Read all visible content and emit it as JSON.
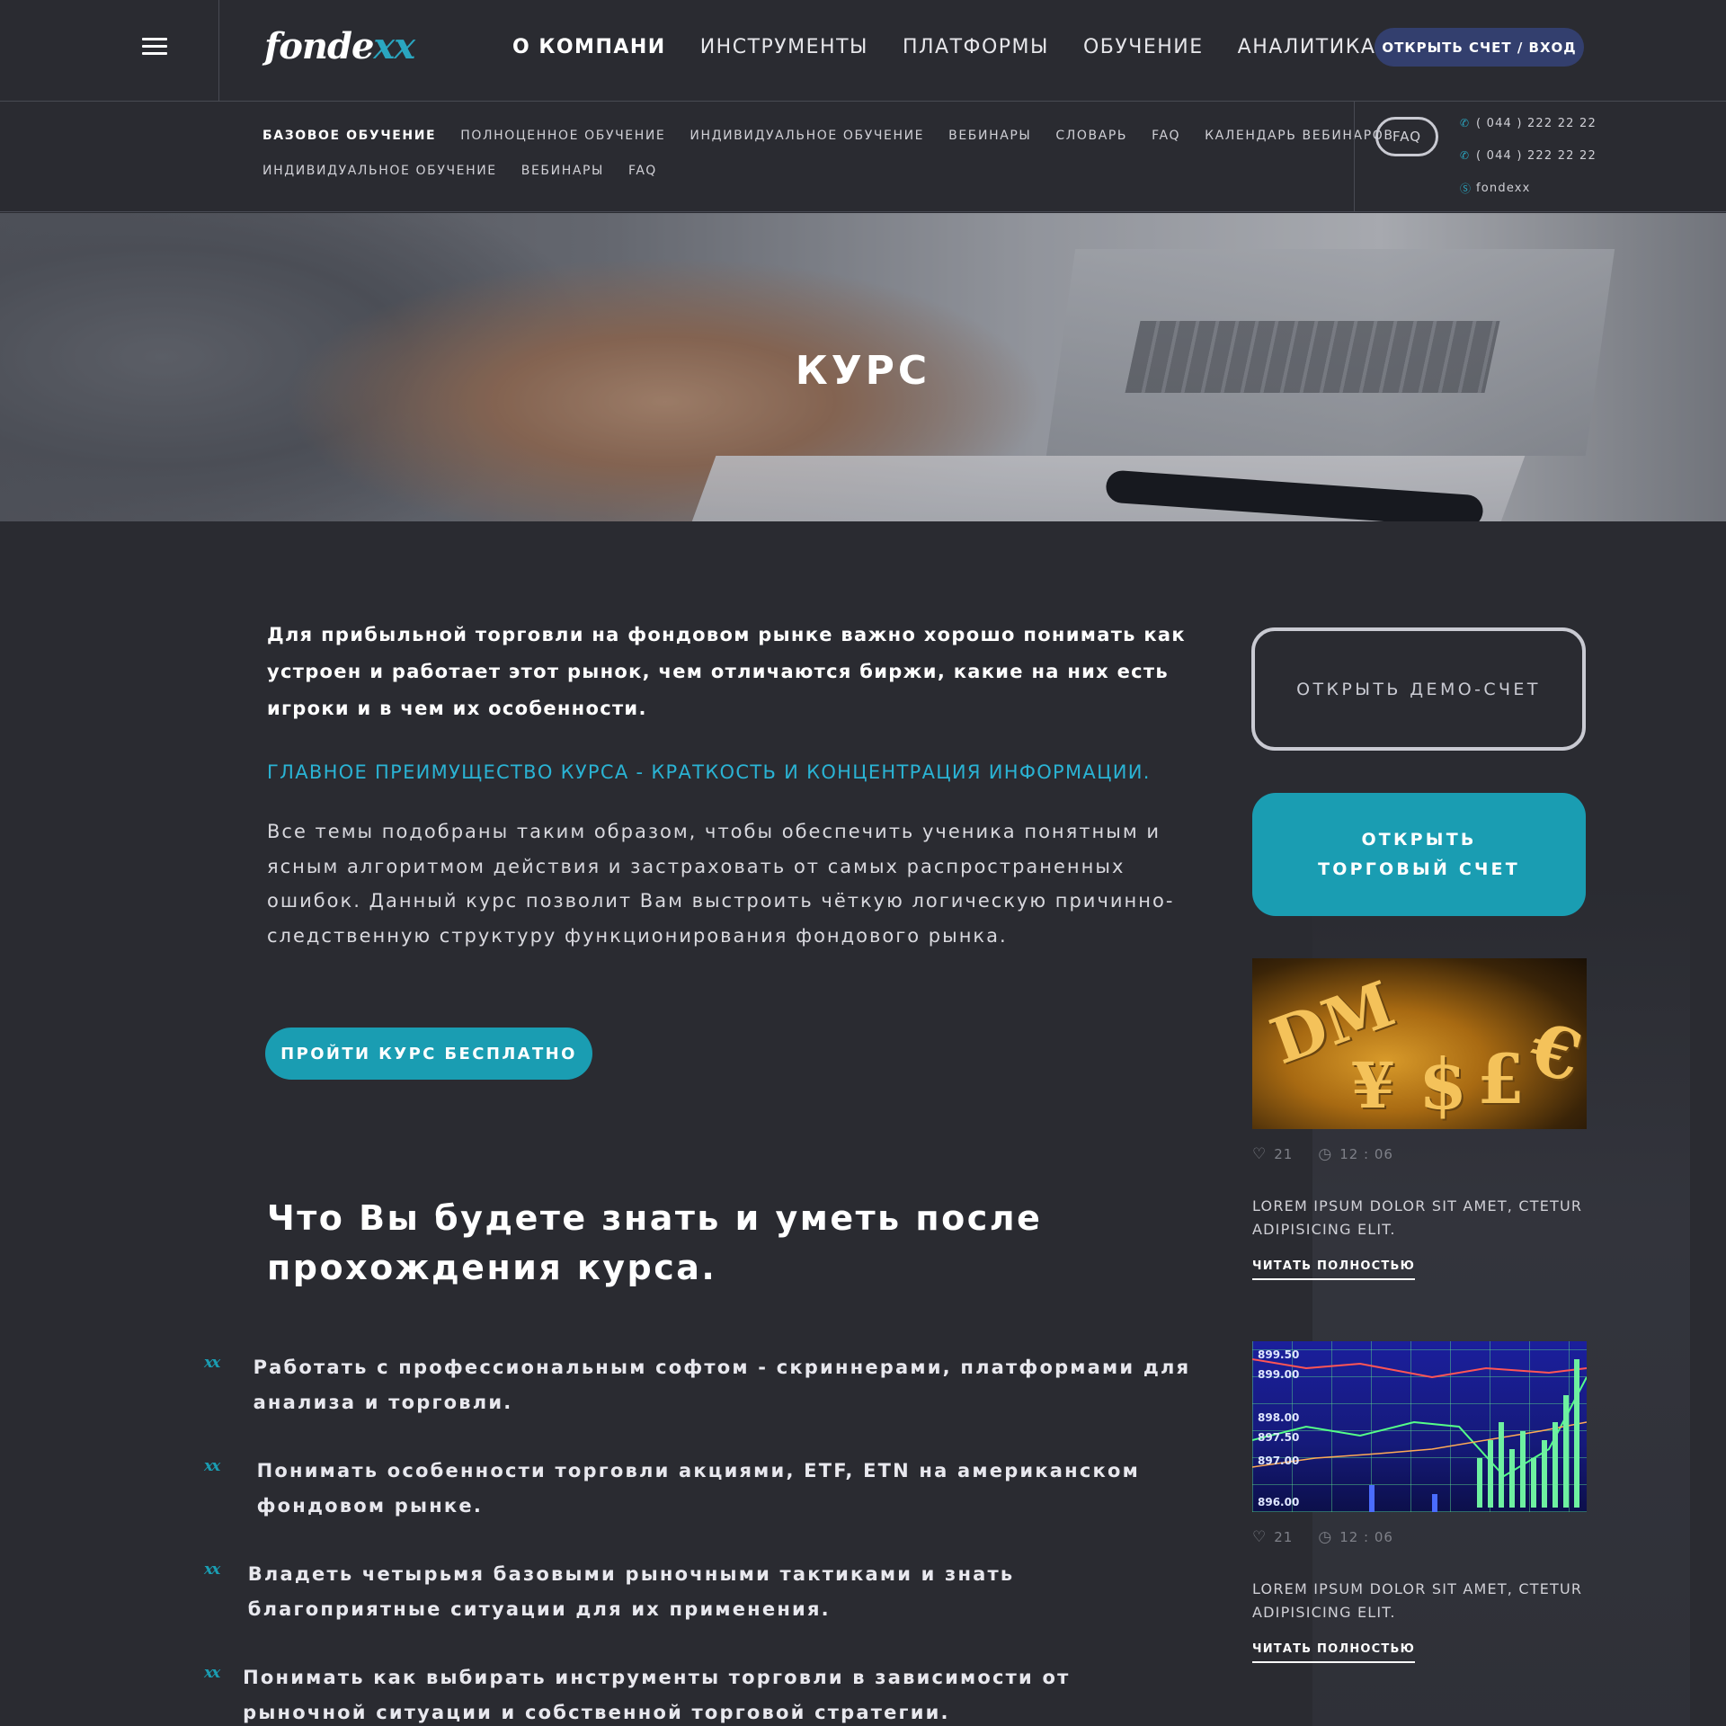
{
  "header": {
    "logo_main": "fonde",
    "logo_accent": "xx",
    "nav": [
      {
        "label": "О КОМПАНИ",
        "active": true
      },
      {
        "label": "ИНСТРУМЕНТЫ",
        "active": false
      },
      {
        "label": "ПЛАТФОРМЫ",
        "active": false
      },
      {
        "label": "ОБУЧЕНИЕ",
        "active": false
      },
      {
        "label": "АНАЛИТИКА",
        "active": false
      }
    ],
    "login_label": "ОТКРЫТЬ СЧЕТ / ВХОД",
    "menu_icon": "hamburger-icon"
  },
  "subnav": {
    "row1": [
      "БАЗОВОЕ ОБУЧЕНИЕ",
      "ПОЛНОЦЕННОЕ ОБУЧЕНИЕ",
      "ИНДИВИДУАЛЬНОЕ ОБУЧЕНИЕ",
      "ВЕБИНАРЫ",
      "СЛОВАРЬ",
      "FAQ",
      "КАЛЕНДАРЬ ВЕБИНАРОВ"
    ],
    "row2": [
      "ИНДИВИДУАЛЬНОЕ ОБУЧЕНИЕ",
      "ВЕБИНАРЫ",
      "FAQ"
    ],
    "faq_label": "FAQ",
    "contacts": [
      {
        "icon": "phone-icon",
        "text": "( 044 ) 222 22 22"
      },
      {
        "icon": "phone-icon",
        "text": "( 044 ) 222 22 22"
      },
      {
        "icon": "skype-icon",
        "text": "fondexx"
      }
    ]
  },
  "hero": {
    "title": "КУРС"
  },
  "content": {
    "lead": "Для прибыльной торговли на фондовом рынке важно хорошо понимать как устроен и работает этот рынок, чем отличаются биржи, какие на них есть игроки и в чем их особенности.",
    "highlight": "ГЛАВНОЕ ПРЕИМУЩЕСТВО КУРСА - КРАТКОСТЬ И КОНЦЕНТРАЦИЯ ИНФОРМАЦИИ.",
    "body": "Все темы подобраны таким образом, чтобы обеспечить ученика понятным и ясным алгоритмом действия и застраховать от самых распространенных ошибок. Данный курс позволит Вам выстроить чёткую логическую причинно-следственную структуру функционирования фондового рынка.",
    "course_button": "ПРОЙТИ КУРС БЕСПЛАТНО",
    "section_title": "Что Вы будете знать и уметь после прохождения курса.",
    "benefit_mark": "xx",
    "benefits": [
      "Работать с профессиональным софтом - скриннерами, платформами для анализа и торговли.",
      "Понимать особенности торговли акциями, ETF, ETN на американском фондовом рынке.",
      "Владеть четырьмя базовыми рыночными тактиками и знать благоприятные ситуации для их применения.",
      "Понимать как выбирать инструменты торговли в зависимости от рыночной ситуации и собственной торговой стратегии."
    ]
  },
  "sidebar": {
    "demo_button": "ОТКРЫТЬ ДЕМО-СЧЕТ",
    "trade_button_line1": "ОТКРЫТЬ",
    "trade_button_line2": "ТОРГОВЫЙ СЧЕТ",
    "cards": [
      {
        "image": "currency-symbols-image",
        "likes": "21",
        "time": "12 : 06",
        "text": "LOREM IPSUM DOLOR SIT AMET, CTETUR ADIPISICING ELIT.",
        "link": "ЧИТАТЬ ПОЛНОСТЬЮ"
      },
      {
        "image": "stock-chart-image",
        "likes": "21",
        "time": "12 : 06",
        "text": "LOREM IPSUM DOLOR SIT AMET, CTETUR ADIPISICING ELIT.",
        "link": "ЧИТАТЬ ПОЛНОСТЬЮ",
        "chart_labels": [
          "899.50",
          "899.00",
          "898.00",
          "897.50",
          "897.00",
          "896.00"
        ]
      }
    ],
    "money_symbols": [
      "DM",
      "¥",
      "$",
      "£",
      "€"
    ]
  },
  "colors": {
    "background": "#2a2b31",
    "accent": "#1a9db2",
    "highlight": "#2ab3d4",
    "login": "#333f6e"
  }
}
